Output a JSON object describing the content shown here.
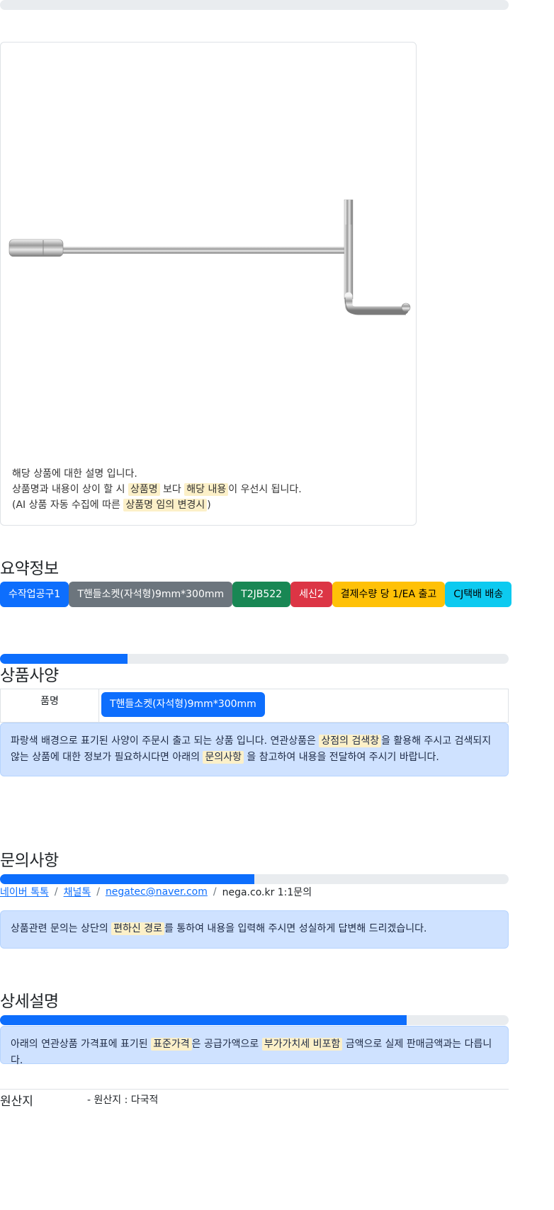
{
  "progress_bars": {
    "top": 0,
    "spec": 0.25,
    "inquiry": 0.5,
    "detail": 0.8
  },
  "product_card": {
    "description_line1": "해당 상품에 대한 설명 입니다.",
    "line2_pre": "상품명과 내용이 상이 할 시",
    "line2_mark1": "상품명",
    "line2_mid": "보다",
    "line2_mark2": "해당 내용",
    "line2_post": "이 우선시 됩니다.",
    "line3_pre": "(AI 상품 자동 수집에 따른",
    "line3_mark": "상품명 임의 변경시",
    "line3_post": ")"
  },
  "summary": {
    "title": "요약정보",
    "badges": [
      {
        "label": "수작업공구1",
        "bg": "#0d6efd",
        "fg": "#ffffff"
      },
      {
        "label": "T핸들소켓(자석형)9mm*300mm",
        "bg": "#6c757d",
        "fg": "#ffffff"
      },
      {
        "label": "T2JB522",
        "bg": "#198754",
        "fg": "#ffffff"
      },
      {
        "label": "세신2",
        "bg": "#dc3545",
        "fg": "#ffffff"
      },
      {
        "label": "결제수량 당 1/EA 출고",
        "bg": "#ffc107",
        "fg": "#000000"
      },
      {
        "label": "CJ택배 배송",
        "bg": "#0dcaf0",
        "fg": "#000000"
      }
    ]
  },
  "spec": {
    "title": "상품사양",
    "row_label": "품명",
    "row_value": "T핸들소켓(자석형)9mm*300mm",
    "alert_pre": "파랑색 배경으로 표기된 사양이 주문시 출고 되는 상품 입니다. 연관상품은",
    "alert_mark1": "상점의 검색창",
    "alert_mid": "을 활용해 주시고 검색되지 않는 상품에 대한 정보가 필요하시다면 아래의",
    "alert_mark2": "문의사항",
    "alert_post": "을 참고하여 내용을 전달하여 주시기 바랍니다."
  },
  "inquiry": {
    "title": "문의사항",
    "links": [
      "네이버 톡톡",
      "채널톡",
      "negatec@naver.com"
    ],
    "last_crumb": "nega.co.kr 1:1문의",
    "alert_pre": "상품관련 문의는 상단의",
    "alert_mark": "편하신 경로",
    "alert_post": "를 통하여 내용을 입력해 주시면 성실하게 답변해 드리겠습니다."
  },
  "detail": {
    "title": "상세설명",
    "alert_pre": "아래의 연관상품 가격표에 표기된",
    "alert_mark1": "표준가격",
    "alert_mid": "은 공급가액으로",
    "alert_mark2": "부가가치세 비포함",
    "alert_post": "금액으로 실제 판매금액과는 다릅니다."
  },
  "origin": {
    "label": "원산지",
    "value": "- 원산지 : 다국적"
  }
}
